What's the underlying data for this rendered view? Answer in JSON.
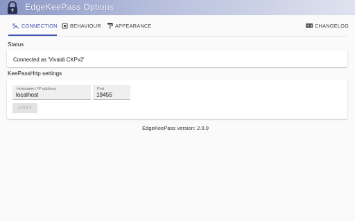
{
  "window": {
    "title": "EdgeKeePass Options"
  },
  "tabs": [
    {
      "label": "CONNECTION",
      "icon": "connection-icon",
      "active": true
    },
    {
      "label": "BEHAVIOUR",
      "icon": "behaviour-icon",
      "active": false
    },
    {
      "label": "APPEARANCE",
      "icon": "paint-roller-icon",
      "active": false
    },
    {
      "label": "CHANGELOG",
      "icon": "new-badge-icon",
      "active": false
    }
  ],
  "status": {
    "heading": "Status",
    "text": "Connected as 'Vivaldi CKPv2'"
  },
  "settings": {
    "heading": "KeePassHttp settings",
    "hostname_label": "Hostname / IP address",
    "hostname_value": "localhost",
    "port_label": "Port",
    "port_value": "19455",
    "apply_label": "APPLY"
  },
  "footer": {
    "version": "EdgeKeePass version: 2.0.0"
  },
  "colors": {
    "accent": "#3f51b5",
    "titlebar_start": "#8a96c6",
    "titlebar_end": "#dfe3ef"
  }
}
